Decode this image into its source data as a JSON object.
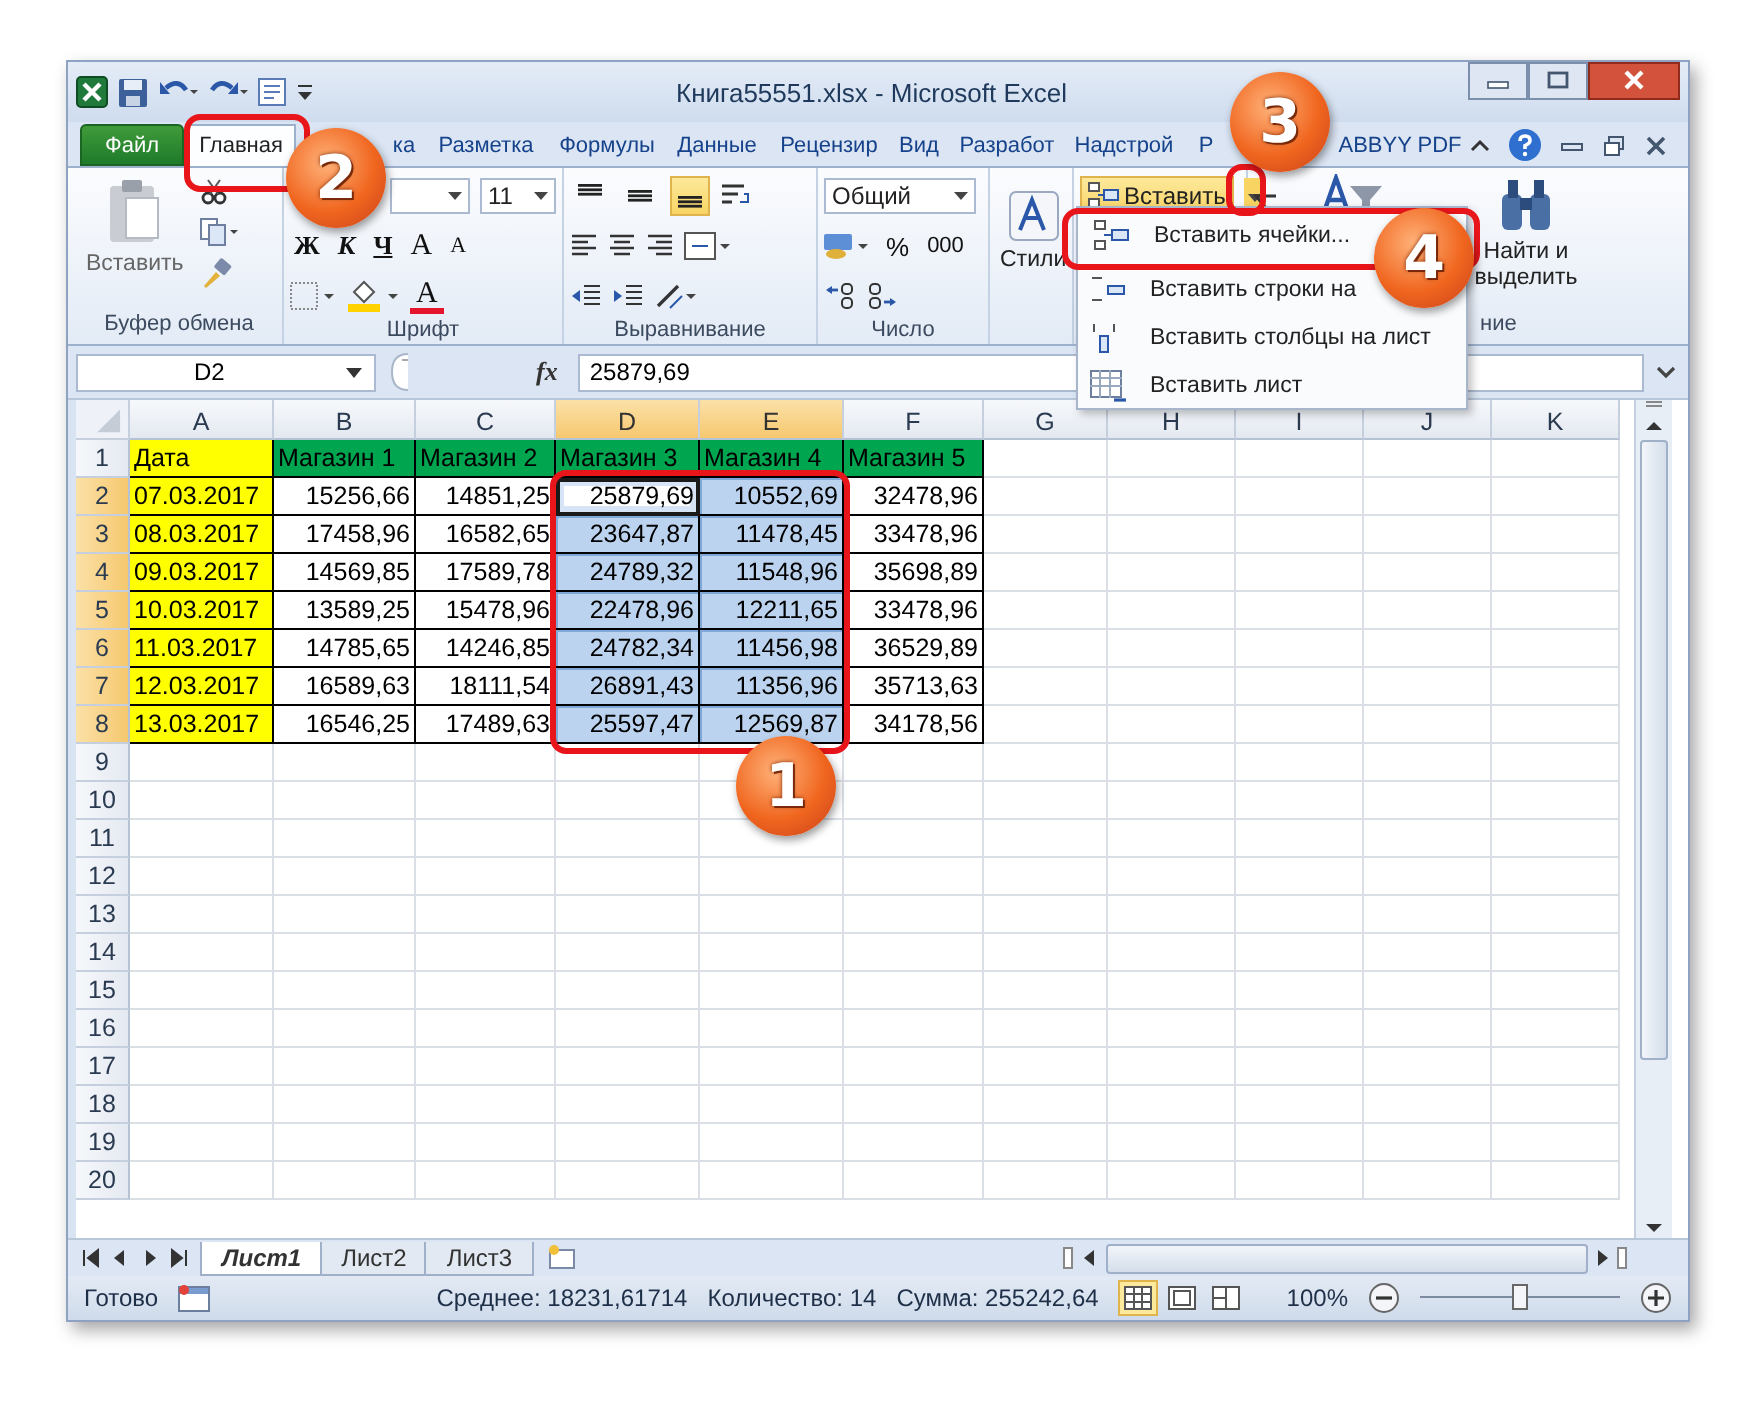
{
  "window": {
    "title": "Книга55551.xlsx - Microsoft Excel"
  },
  "ribbon_tabs": [
    {
      "label": "Файл",
      "kind": "file",
      "selected": false
    },
    {
      "label": "Главная",
      "kind": "tab",
      "selected": true
    },
    {
      "label": "ка",
      "kind": "tab",
      "selected": false
    },
    {
      "label": "Разметка",
      "kind": "tab",
      "selected": false
    },
    {
      "label": "Формулы",
      "kind": "tab",
      "selected": false
    },
    {
      "label": "Данные",
      "kind": "tab",
      "selected": false
    },
    {
      "label": "Рецензир",
      "kind": "tab",
      "selected": false
    },
    {
      "label": "Вид",
      "kind": "tab",
      "selected": false
    },
    {
      "label": "Разработ",
      "kind": "tab",
      "selected": false
    },
    {
      "label": "Надстрой",
      "kind": "tab",
      "selected": false
    },
    {
      "label": "Р",
      "kind": "tab",
      "selected": false
    },
    {
      "label": "ABBYY PDF",
      "kind": "tab",
      "selected": false
    }
  ],
  "ribbon": {
    "clipboard": {
      "paste": "Вставить",
      "group": "Буфер обмена"
    },
    "font": {
      "size": "11",
      "bold": "Ж",
      "italic": "К",
      "underline": "Ч",
      "grow": "A",
      "shrink": "A",
      "color_letter": "A",
      "group": "Шрифт"
    },
    "alignment": {
      "vertical": [
        {
          "selected": false
        },
        {
          "selected": false
        },
        {
          "selected": true
        }
      ],
      "group": "Выравнивание"
    },
    "number": {
      "format": "Общий",
      "percent": "%",
      "thousands": "000",
      "group": "Число"
    },
    "styles": {
      "label": "Стили"
    },
    "cells": {
      "insert": "Вставить",
      "menu_open": true
    },
    "editing": {
      "find": "Найти и выделить",
      "group": "ние"
    }
  },
  "insert_menu": [
    {
      "label": "Вставить ячейки...",
      "kind": "cells"
    },
    {
      "label": "Вставить строки на",
      "kind": "rows"
    },
    {
      "label": "Вставить столбцы на лист",
      "kind": "columns"
    },
    {
      "label": "Вставить лист",
      "kind": "sheet"
    }
  ],
  "formula_bar": {
    "name_box": "D2",
    "fx": "fx",
    "value": "25879,69"
  },
  "sheet": {
    "columns": [
      {
        "label": "A",
        "selected": false
      },
      {
        "label": "B",
        "selected": false
      },
      {
        "label": "C",
        "selected": false
      },
      {
        "label": "D",
        "selected": true
      },
      {
        "label": "E",
        "selected": true
      },
      {
        "label": "F",
        "selected": false
      },
      {
        "label": "G",
        "selected": false
      },
      {
        "label": "H",
        "selected": false
      },
      {
        "label": "I",
        "selected": false
      },
      {
        "label": "J",
        "selected": false
      },
      {
        "label": "K",
        "selected": false
      }
    ],
    "rows": [
      {
        "number": "1",
        "selected": false,
        "cells": [
          {
            "text": "Дата",
            "kind": "text",
            "color": "#ffff00",
            "selected": false,
            "active": false
          },
          {
            "text": "Магазин 1",
            "kind": "text",
            "color": "#00a550",
            "selected": false,
            "active": false
          },
          {
            "text": "Магазин 2",
            "kind": "text",
            "color": "#00a550",
            "selected": false,
            "active": false
          },
          {
            "text": "Магазин 3",
            "kind": "text",
            "color": "#00a550",
            "selected": false,
            "active": false
          },
          {
            "text": "Магазин 4",
            "kind": "text",
            "color": "#00a550",
            "selected": false,
            "active": false
          },
          {
            "text": "Магазин 5",
            "kind": "text",
            "color": "#00a550",
            "selected": false,
            "active": false
          }
        ]
      },
      {
        "number": "2",
        "selected": true,
        "cells": [
          {
            "text": "07.03.2017",
            "kind": "date",
            "color": "#ffff00",
            "selected": false,
            "active": false
          },
          {
            "text": "15256,66",
            "kind": "number",
            "selected": false,
            "active": false
          },
          {
            "text": "14851,25",
            "kind": "number",
            "selected": false,
            "active": false
          },
          {
            "text": "25879,69",
            "kind": "number",
            "selected": true,
            "active": true
          },
          {
            "text": "10552,69",
            "kind": "number",
            "selected": true,
            "active": false
          },
          {
            "text": "32478,96",
            "kind": "number",
            "selected": false,
            "active": false
          }
        ]
      },
      {
        "number": "3",
        "selected": true,
        "cells": [
          {
            "text": "08.03.2017",
            "kind": "date",
            "color": "#ffff00",
            "selected": false,
            "active": false
          },
          {
            "text": "17458,96",
            "kind": "number",
            "selected": false,
            "active": false
          },
          {
            "text": "16582,65",
            "kind": "number",
            "selected": false,
            "active": false
          },
          {
            "text": "23647,87",
            "kind": "number",
            "selected": true,
            "active": false
          },
          {
            "text": "11478,45",
            "kind": "number",
            "selected": true,
            "active": false
          },
          {
            "text": "33478,96",
            "kind": "number",
            "selected": false,
            "active": false
          }
        ]
      },
      {
        "number": "4",
        "selected": true,
        "cells": [
          {
            "text": "09.03.2017",
            "kind": "date",
            "color": "#ffff00",
            "selected": false,
            "active": false
          },
          {
            "text": "14569,85",
            "kind": "number",
            "selected": false,
            "active": false
          },
          {
            "text": "17589,78",
            "kind": "number",
            "selected": false,
            "active": false
          },
          {
            "text": "24789,32",
            "kind": "number",
            "selected": true,
            "active": false
          },
          {
            "text": "11548,96",
            "kind": "number",
            "selected": true,
            "active": false
          },
          {
            "text": "35698,89",
            "kind": "number",
            "selected": false,
            "active": false
          }
        ]
      },
      {
        "number": "5",
        "selected": true,
        "cells": [
          {
            "text": "10.03.2017",
            "kind": "date",
            "color": "#ffff00",
            "selected": false,
            "active": false
          },
          {
            "text": "13589,25",
            "kind": "number",
            "selected": false,
            "active": false
          },
          {
            "text": "15478,96",
            "kind": "number",
            "selected": false,
            "active": false
          },
          {
            "text": "22478,96",
            "kind": "number",
            "selected": true,
            "active": false
          },
          {
            "text": "12211,65",
            "kind": "number",
            "selected": true,
            "active": false
          },
          {
            "text": "33478,96",
            "kind": "number",
            "selected": false,
            "active": false
          }
        ]
      },
      {
        "number": "6",
        "selected": true,
        "cells": [
          {
            "text": "11.03.2017",
            "kind": "date",
            "color": "#ffff00",
            "selected": false,
            "active": false
          },
          {
            "text": "14785,65",
            "kind": "number",
            "selected": false,
            "active": false
          },
          {
            "text": "14246,85",
            "kind": "number",
            "selected": false,
            "active": false
          },
          {
            "text": "24782,34",
            "kind": "number",
            "selected": true,
            "active": false
          },
          {
            "text": "11456,98",
            "kind": "number",
            "selected": true,
            "active": false
          },
          {
            "text": "36529,89",
            "kind": "number",
            "selected": false,
            "active": false
          }
        ]
      },
      {
        "number": "7",
        "selected": true,
        "cells": [
          {
            "text": "12.03.2017",
            "kind": "date",
            "color": "#ffff00",
            "selected": false,
            "active": false
          },
          {
            "text": "16589,63",
            "kind": "number",
            "selected": false,
            "active": false
          },
          {
            "text": "18111,54",
            "kind": "number",
            "selected": false,
            "active": false
          },
          {
            "text": "26891,43",
            "kind": "number",
            "selected": true,
            "active": false
          },
          {
            "text": "11356,96",
            "kind": "number",
            "selected": true,
            "active": false
          },
          {
            "text": "35713,63",
            "kind": "number",
            "selected": false,
            "active": false
          }
        ]
      },
      {
        "number": "8",
        "selected": true,
        "cells": [
          {
            "text": "13.03.2017",
            "kind": "date",
            "color": "#ffff00",
            "selected": false,
            "active": false
          },
          {
            "text": "16546,25",
            "kind": "number",
            "selected": false,
            "active": false
          },
          {
            "text": "17489,63",
            "kind": "number",
            "selected": false,
            "active": false
          },
          {
            "text": "25597,47",
            "kind": "number",
            "selected": true,
            "active": false
          },
          {
            "text": "12569,87",
            "kind": "number",
            "selected": true,
            "active": false
          },
          {
            "text": "34178,56",
            "kind": "number",
            "selected": false,
            "active": false
          }
        ]
      },
      {
        "number": "9",
        "selected": false
      },
      {
        "number": "10",
        "selected": false
      },
      {
        "number": "11",
        "selected": false
      },
      {
        "number": "12",
        "selected": false
      },
      {
        "number": "13",
        "selected": false
      },
      {
        "number": "14",
        "selected": false
      },
      {
        "number": "15",
        "selected": false
      },
      {
        "number": "16",
        "selected": false
      },
      {
        "number": "17",
        "selected": false
      },
      {
        "number": "18",
        "selected": false
      },
      {
        "number": "19",
        "selected": false
      },
      {
        "number": "20",
        "selected": false
      }
    ]
  },
  "sheet_tabs": [
    {
      "label": "Лист1",
      "selected": true
    },
    {
      "label": "Лист2",
      "selected": false
    },
    {
      "label": "Лист3",
      "selected": false
    }
  ],
  "status_bar": {
    "ready": "Готово",
    "average": "Среднее: 18231,61714",
    "count": "Количество: 14",
    "sum": "Сумма: 255242,64",
    "views": [
      {
        "kind": "normal",
        "selected": true
      },
      {
        "kind": "layout",
        "selected": false
      },
      {
        "kind": "break",
        "selected": false
      }
    ],
    "zoom": "100%",
    "zoom_slider": {
      "level": 0.5
    }
  },
  "annotations": [
    {
      "label": "1"
    },
    {
      "label": "2"
    },
    {
      "label": "3"
    },
    {
      "label": "4"
    }
  ]
}
